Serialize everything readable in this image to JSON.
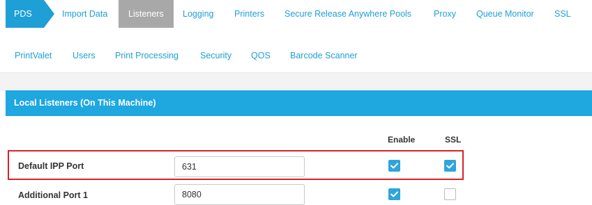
{
  "nav": {
    "row1": [
      {
        "id": "pds",
        "label": "PDS"
      },
      {
        "id": "import-data",
        "label": "Import Data"
      },
      {
        "id": "listeners",
        "label": "Listeners",
        "active": true
      },
      {
        "id": "logging",
        "label": "Logging"
      },
      {
        "id": "printers",
        "label": "Printers"
      },
      {
        "id": "secure-release-anywhere-pools",
        "label": "Secure Release Anywhere Pools"
      },
      {
        "id": "proxy",
        "label": "Proxy"
      },
      {
        "id": "queue-monitor",
        "label": "Queue Monitor"
      },
      {
        "id": "ssl",
        "label": "SSL"
      }
    ],
    "row2": [
      {
        "id": "printvalet",
        "label": "PrintValet"
      },
      {
        "id": "users",
        "label": "Users"
      },
      {
        "id": "print-processing",
        "label": "Print Processing"
      },
      {
        "id": "security",
        "label": "Security"
      },
      {
        "id": "qos",
        "label": "QOS"
      },
      {
        "id": "barcode-scanner",
        "label": "Barcode Scanner"
      }
    ]
  },
  "panel": {
    "title": "Local Listeners (On This Machine)",
    "columns": {
      "enable": "Enable",
      "ssl": "SSL"
    },
    "rows": [
      {
        "label": "Default IPP Port",
        "port": "631",
        "enable": true,
        "ssl": true
      },
      {
        "label": "Additional Port 1",
        "port": "8080",
        "enable": true,
        "ssl": false
      }
    ]
  },
  "colors": {
    "accent": "#1fa7e0",
    "active_tab": "#a8a8a8",
    "highlight": "#d9222a",
    "checkbox_checked": "#2ea5dc"
  }
}
